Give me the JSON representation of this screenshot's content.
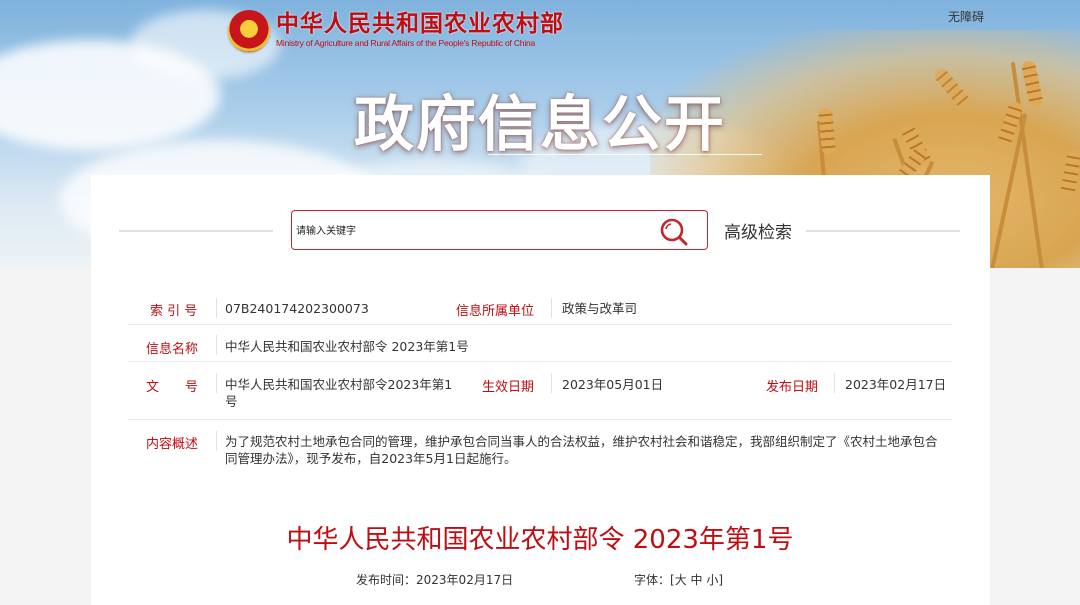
{
  "header": {
    "site_name_cn": "中华人民共和国农业农村部",
    "site_name_en": "Ministry of Agriculture and Rural Affairs of the People's Republic of China",
    "accessibility_link": "无障碍",
    "hero_title": "政府信息公开"
  },
  "search": {
    "placeholder": "请输入关键字",
    "search_icon": "search-icon",
    "advanced_label": "高级检索"
  },
  "info": {
    "index_label": "索 引 号",
    "index_value": "07B240174202300073",
    "org_label": "信息所属单位",
    "org_value": "政策与改革司",
    "name_label": "信息名称",
    "name_value": "中华人民共和国农业农村部令 2023年第1号",
    "docno_label": "文　　号",
    "docno_value": "中华人民共和国农业农村部令2023年第1号",
    "effective_label": "生效日期",
    "effective_value": "2023年05月01日",
    "publish_label": "发布日期",
    "publish_value": "2023年02月17日",
    "summary_label": "内容概述",
    "summary_value": "为了规范农村土地承包合同的管理，维护承包合同当事人的合法权益，维护农村社会和谐稳定，我部组织制定了《农村土地承包合同管理办法》，现予发布，自2023年5月1日起施行。"
  },
  "article": {
    "title": "中华人民共和国农业农村部令 2023年第1号",
    "publish_time_label": "发布时间：",
    "publish_time": "2023年02月17日",
    "font_label": "字体：",
    "font_open": "[",
    "font_large": "大",
    "font_medium": "中",
    "font_small": "小",
    "font_close": "]"
  },
  "colors": {
    "accent": "#c00d12",
    "border": "#c3272b"
  }
}
